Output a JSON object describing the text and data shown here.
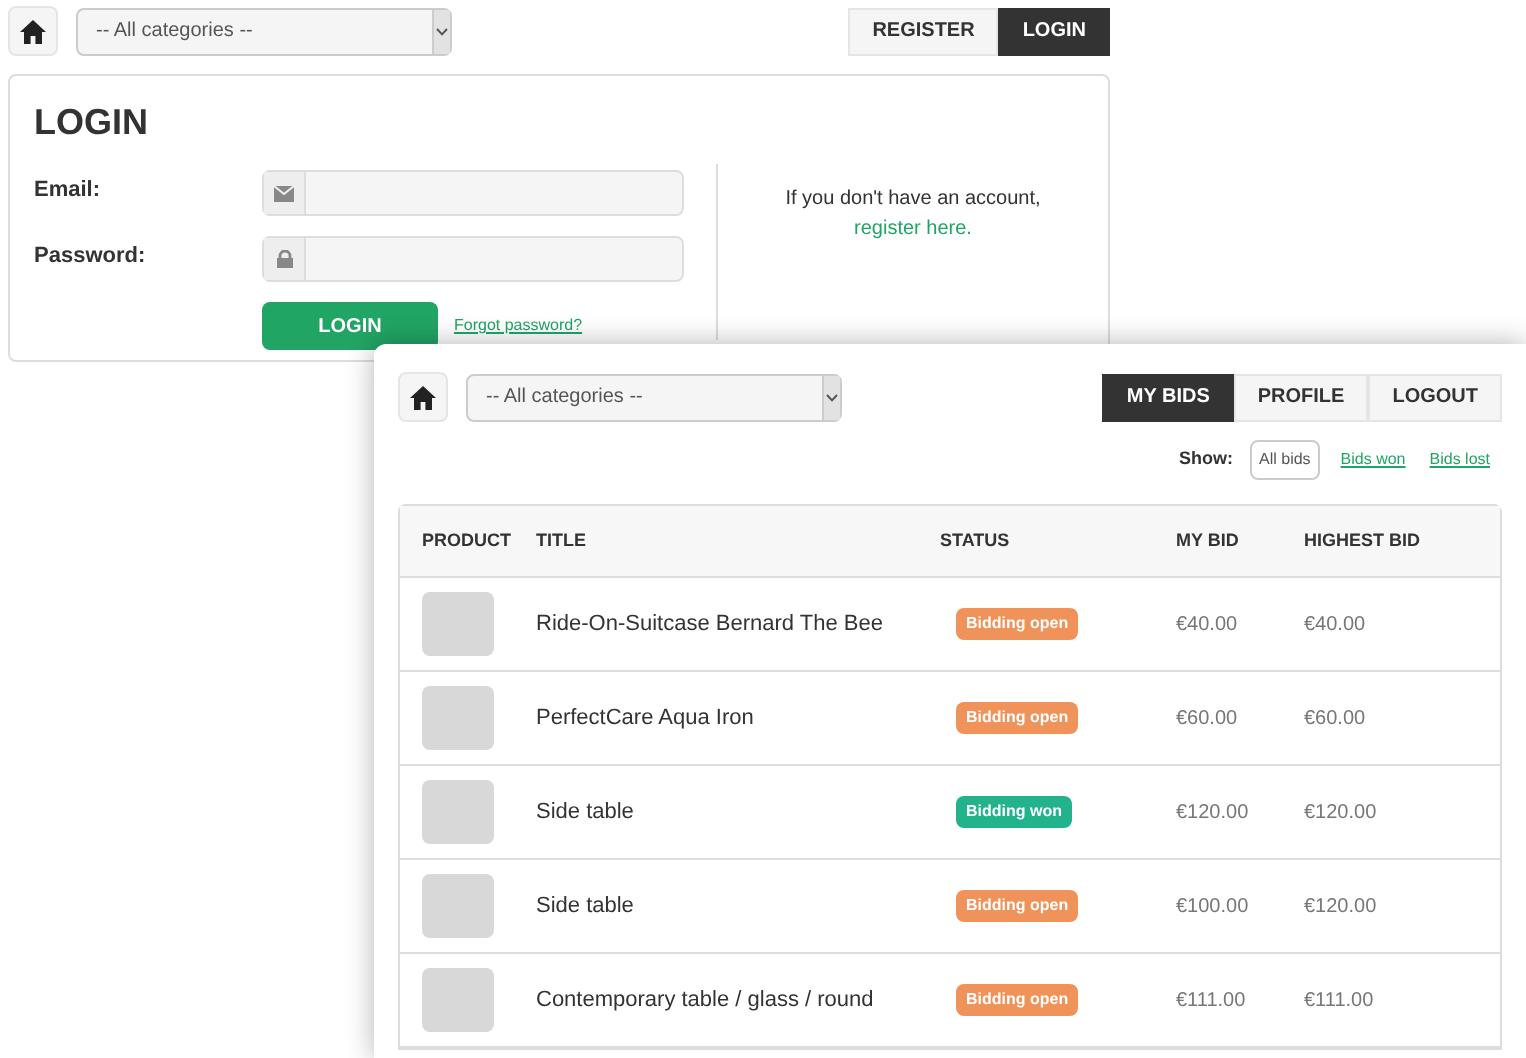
{
  "login_page": {
    "category_select": {
      "value": "-- All categories --"
    },
    "nav": [
      {
        "label": "REGISTER",
        "selected": false
      },
      {
        "label": "LOGIN",
        "selected": true
      }
    ],
    "title": "LOGIN",
    "fields": [
      {
        "label": "Email:",
        "kind": "email"
      },
      {
        "label": "Password:",
        "kind": "password"
      }
    ],
    "submit": "LOGIN",
    "forgot_link": "Forgot password?",
    "register_text": "If you don't have an account,",
    "register_link": "register here."
  },
  "bids_page": {
    "category_select": {
      "value": "-- All categories --"
    },
    "nav": [
      {
        "label": "MY BIDS",
        "selected": true
      },
      {
        "label": "PROFILE",
        "selected": false
      },
      {
        "label": "LOGOUT",
        "selected": false
      }
    ],
    "filter_label": "Show:",
    "filters": [
      {
        "label": "All bids",
        "selected": true
      },
      {
        "label": "Bids won",
        "selected": false
      },
      {
        "label": "Bids lost",
        "selected": false
      }
    ],
    "table": {
      "columns": [
        "PRODUCT",
        "TITLE",
        "STATUS",
        "MY BID",
        "HIGHEST BID"
      ],
      "rows": [
        {
          "title": "Ride-On-Suitcase Bernard The Bee",
          "status": {
            "label": "Bidding open",
            "kind": "open"
          },
          "my_bid": "€40.00",
          "highest_bid": "€40.00"
        },
        {
          "title": "PerfectCare Aqua Iron",
          "status": {
            "label": "Bidding open",
            "kind": "open"
          },
          "my_bid": "€60.00",
          "highest_bid": "€60.00"
        },
        {
          "title": "Side table",
          "status": {
            "label": "Bidding won",
            "kind": "won"
          },
          "my_bid": "€120.00",
          "highest_bid": "€120.00"
        },
        {
          "title": "Side table",
          "status": {
            "label": "Bidding open",
            "kind": "open"
          },
          "my_bid": "€100.00",
          "highest_bid": "€120.00"
        },
        {
          "title": "Contemporary table / glass / round",
          "status": {
            "label": "Bidding open",
            "kind": "open"
          },
          "my_bid": "€111.00",
          "highest_bid": "€111.00"
        }
      ]
    }
  }
}
